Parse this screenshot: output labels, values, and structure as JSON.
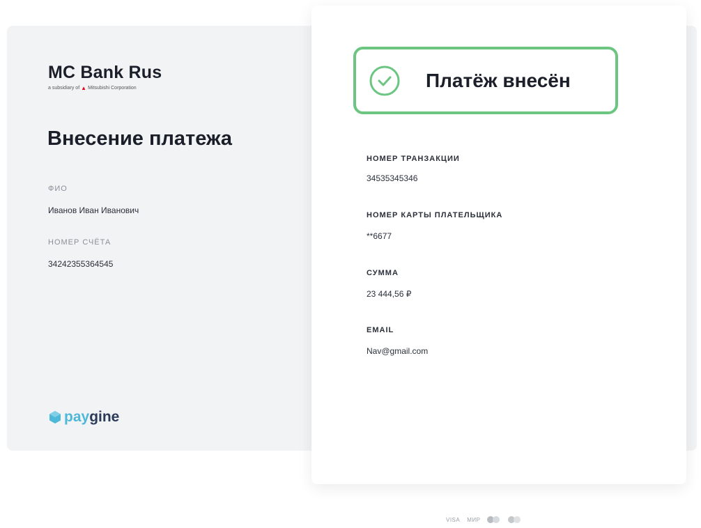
{
  "bank": {
    "name": "MC Bank Rus",
    "subtitle_pre": "a subsidiary of",
    "subtitle_post": "Mitsubishi Corporation"
  },
  "payment_form": {
    "title": "Внесение платежа",
    "fio_label": "ФИО",
    "fio_value": "Иванов Иван Иванович",
    "account_label": "НОМЕР СЧЁТА",
    "account_value": "34242355364545"
  },
  "provider": {
    "pay": "pay",
    "gine": "gine"
  },
  "status": {
    "text": "Платёж внесён",
    "color": "#6cc682"
  },
  "details": {
    "transaction_label": "НОМЕР ТРАНЗАКЦИИ",
    "transaction_value": "34535345346",
    "card_label": "НОМЕР КАРТЫ ПЛАТЕЛЬЩИКА",
    "card_value": "**6677",
    "amount_label": "СУММА",
    "amount_value": "23 444,56 ₽",
    "email_label": "EMAIL",
    "email_value": "Nav@gmail.com"
  },
  "footer": {
    "visa": "VISA",
    "mir": "МИР",
    "icons": [
      "mastercard-icon",
      "maestro-icon"
    ]
  },
  "colors": {
    "accent_green": "#6cc682",
    "panel_bg": "#f2f3f5",
    "paygine_blue": "#4db8d8",
    "paygine_dark": "#2a3a57"
  }
}
